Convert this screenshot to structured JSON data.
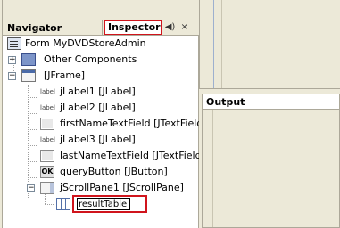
{
  "navigator_panel": {
    "tabs": [
      {
        "label": "Navigator",
        "active": false
      },
      {
        "label": "Inspector",
        "active": true
      }
    ],
    "controls": [
      {
        "icon": "restore-icon",
        "glyph": "◀)"
      },
      {
        "icon": "close-icon",
        "glyph": "×"
      }
    ]
  },
  "tree": {
    "form": {
      "label": "Form MyDVDStoreAdmin",
      "icon": "form-icon"
    },
    "other": {
      "label": "Other Components",
      "icon": "other-components-icon",
      "expander": "+"
    },
    "frame": {
      "label": "[JFrame]",
      "icon": "jframe-icon",
      "expander": "−"
    },
    "children": [
      {
        "label": "jLabel1 [JLabel]",
        "icon": "jlabel-icon",
        "glyph": "label"
      },
      {
        "label": "jLabel2 [JLabel]",
        "icon": "jlabel-icon",
        "glyph": "label"
      },
      {
        "label": "firstNameTextField [JTextField]",
        "icon": "jtextfield-icon",
        "glyph": ""
      },
      {
        "label": "jLabel3 [JLabel]",
        "icon": "jlabel-icon",
        "glyph": "label"
      },
      {
        "label": "lastNameTextField [JTextField]",
        "icon": "jtextfield-icon",
        "glyph": ""
      },
      {
        "label": "queryButton [JButton]",
        "icon": "jbutton-icon",
        "glyph": "OK"
      },
      {
        "label": "jScrollPane1 [JScrollPane]",
        "icon": "jscrollpane-icon",
        "glyph": "",
        "expander": "−"
      }
    ],
    "rename_edit": {
      "value": "resultTable",
      "icon": "jtable-icon"
    }
  },
  "output_panel": {
    "title": "Output"
  },
  "colors": {
    "highlight": "#d0141c",
    "panel_bg": "#ece9d8"
  }
}
